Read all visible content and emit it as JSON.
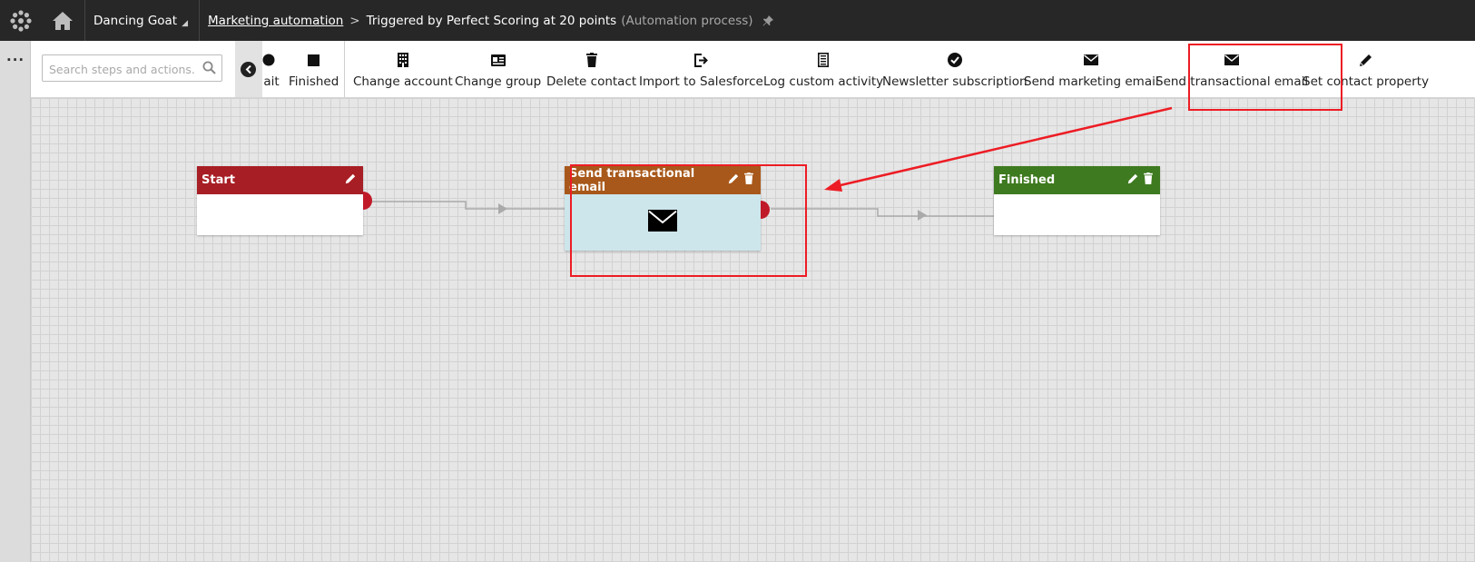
{
  "header": {
    "site": "Dancing Goat",
    "breadcrumb_link": "Marketing automation",
    "breadcrumb_sep": ">",
    "process_title": "Triggered by Perfect Scoring at 20 points",
    "process_type": "(Automation process)"
  },
  "toolbar": {
    "search_placeholder": "Search steps and actions.",
    "tools": [
      {
        "label": "Wait",
        "visible_label": "ait",
        "icon": "clock-icon"
      },
      {
        "label": "Finished",
        "icon": "stop-square-icon"
      },
      {
        "label": "Change account",
        "icon": "building-icon"
      },
      {
        "label": "Change group",
        "icon": "contact-card-icon"
      },
      {
        "label": "Delete contact",
        "icon": "trash-icon"
      },
      {
        "label": "Import to Salesforce",
        "icon": "sign-out-icon"
      },
      {
        "label": "Log custom activity",
        "icon": "list-doc-icon"
      },
      {
        "label": "Newsletter subscription",
        "icon": "checkmark-circle-icon"
      },
      {
        "label": "Send marketing email",
        "icon": "envelope-icon"
      },
      {
        "label": "Send transactional email",
        "icon": "envelope-icon"
      },
      {
        "label": "Set contact property",
        "icon": "pencil-icon"
      }
    ]
  },
  "workflow": {
    "nodes": [
      {
        "id": "start",
        "title": "Start",
        "color": "#a71e24"
      },
      {
        "id": "send",
        "title": "Send transactional email",
        "color": "#a8581a",
        "body_color": "#cde6ec",
        "icon": "envelope-icon"
      },
      {
        "id": "finished",
        "title": "Finished",
        "color": "#3e7a1f"
      }
    ]
  },
  "colors": {
    "topbar": "#272727",
    "highlight": "#ed1c24",
    "connector": "#aaaaaa",
    "port": "#c01a28"
  }
}
